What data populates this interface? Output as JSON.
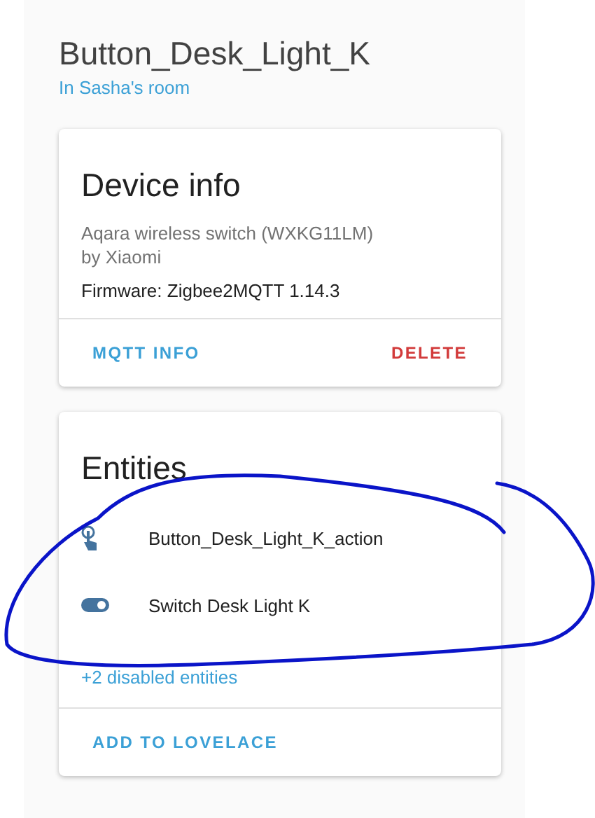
{
  "device": {
    "name": "Button_Desk_Light_K",
    "area": "In Sasha's room"
  },
  "device_info": {
    "title": "Device info",
    "model": "Aqara wireless switch (WXKG11LM)",
    "manufacturer": "by Xiaomi",
    "firmware": "Firmware: Zigbee2MQTT 1.14.3",
    "actions": [
      {
        "label": "MQTT INFO",
        "kind": "primary"
      },
      {
        "label": "DELETE",
        "kind": "danger"
      }
    ]
  },
  "entities": {
    "title": "Entities",
    "items": [
      {
        "name": "Button_Desk_Light_K_action",
        "kind": "touch"
      },
      {
        "name": "Switch Desk Light K",
        "kind": "switch"
      }
    ],
    "disabled_link": "+2 disabled entities",
    "action": "ADD TO LOVELACE"
  }
}
